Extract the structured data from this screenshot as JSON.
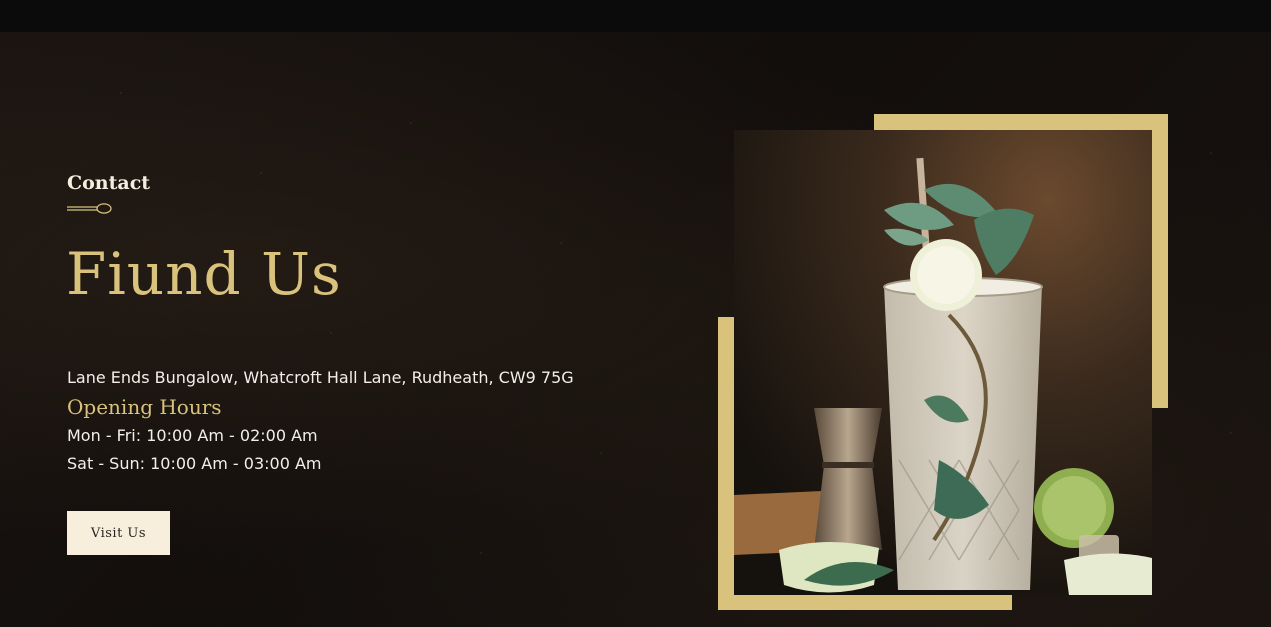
{
  "section": {
    "eyebrow": "Contact",
    "headline": "Fiund Us",
    "address": "Lane Ends Bungalow, Whatcroft Hall Lane, Rudheath, CW9 75G",
    "hours_title": "Opening Hours",
    "hours": [
      "Mon - Fri: 10:00 Am - 02:00 Am",
      "Sat - Sun: 10:00 Am - 03:00 Am"
    ],
    "button_label": "Visit Us"
  },
  "colors": {
    "accent_gold": "#d8c27c",
    "text_light": "#f2efe8",
    "button_bg": "#f7eedc",
    "background": "#120e0c"
  },
  "icons": {
    "divider": "spoon-divider-icon",
    "image": "mojito-cocktail-image"
  }
}
